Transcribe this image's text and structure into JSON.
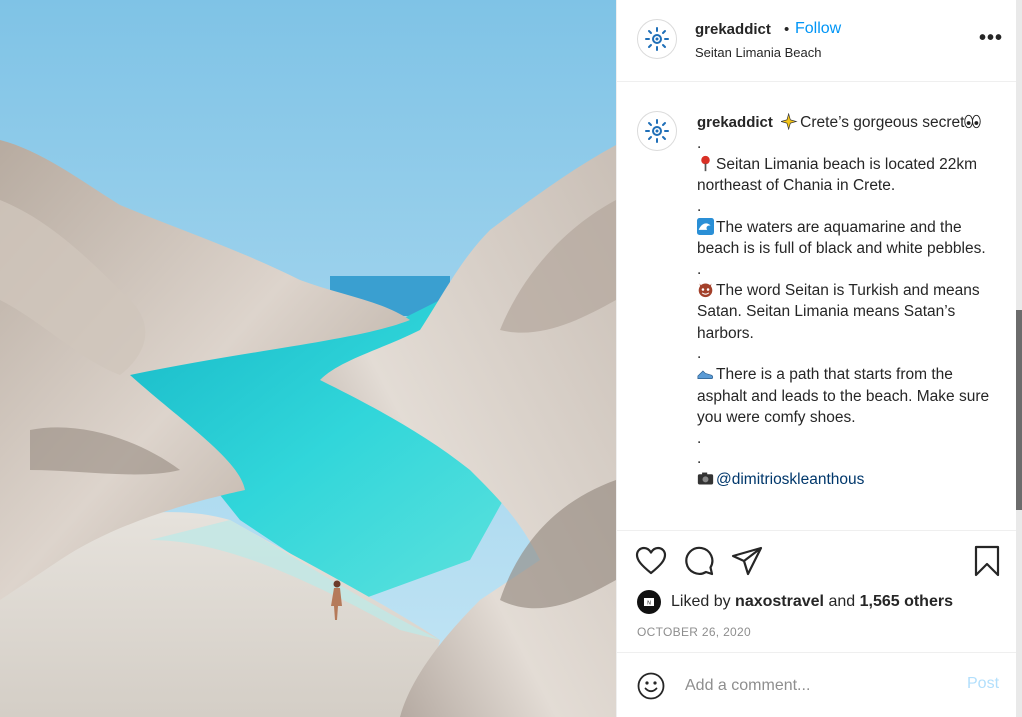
{
  "post": {
    "username": "grekaddict",
    "separator": "•",
    "follow_label": "Follow",
    "location": "Seitan Limania Beach",
    "more_label": "•••"
  },
  "caption": {
    "username": "grekaddict",
    "title": "Crete’s gorgeous secret",
    "dot": ".",
    "para1": "Seitan Limania beach is located 22km northeast of Chania in Crete.",
    "para2": "The waters are aquamarine and the beach is is full of black and white pebbles.",
    "para3": "The word Seitan is Turkish and means Satan. Seitan Limania means Satan’s harbors.",
    "para4": "There is a path that starts from the asphalt and leads to the beach. Make sure you were comfy shoes.",
    "credit": "@dimitrioskleanthous"
  },
  "icons": {
    "like": "heart-icon",
    "comment": "speech-bubble-icon",
    "share": "paper-plane-icon",
    "save": "bookmark-icon",
    "emoji": "smiley-icon"
  },
  "likes": {
    "prefix": "Liked by",
    "user": "naxostravel",
    "middle": "and",
    "others": "1,565 others"
  },
  "date": "OCTOBER 26, 2020",
  "comment": {
    "placeholder": "Add a comment...",
    "post_label": "Post"
  },
  "colors": {
    "accent": "#0095f6",
    "post_disabled": "#b2dffc",
    "water": "#2fd3d8",
    "sky": "#a9d8f0"
  }
}
